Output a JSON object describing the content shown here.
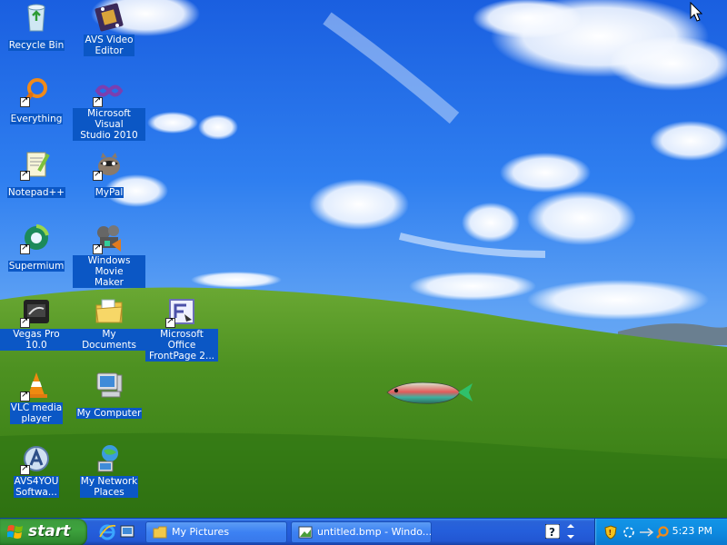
{
  "desktop": {
    "icons": [
      {
        "label": "Recycle Bin",
        "icon": "recycle-bin-icon",
        "shortcut": false
      },
      {
        "label": "AVS Video\nEditor",
        "icon": "film-icon",
        "shortcut": false
      },
      {
        "label": "Everything",
        "icon": "magnifier-icon",
        "shortcut": true
      },
      {
        "label": "Microsoft Visual\nStudio 2010",
        "icon": "visual-studio-icon",
        "shortcut": true
      },
      {
        "label": "Notepad++",
        "icon": "notepad-icon",
        "shortcut": true
      },
      {
        "label": "MyPal",
        "icon": "raccoon-icon",
        "shortcut": true
      },
      {
        "label": "Supermium",
        "icon": "globe-icon",
        "shortcut": true
      },
      {
        "label": "Windows Movie\nMaker",
        "icon": "movie-maker-icon",
        "shortcut": true
      },
      {
        "label": "Vegas Pro 10.0",
        "icon": "vegas-icon",
        "shortcut": true
      },
      {
        "label": "My Documents",
        "icon": "folder-icon",
        "shortcut": false
      },
      {
        "label": "Microsoft Office\nFrontPage 2...",
        "icon": "frontpage-icon",
        "shortcut": true
      },
      {
        "label": "VLC media\nplayer",
        "icon": "traffic-cone-icon",
        "shortcut": true
      },
      {
        "label": "My Computer",
        "icon": "computer-icon",
        "shortcut": false
      },
      {
        "label": "AVS4YOU\nSoftwa...",
        "icon": "avs-icon",
        "shortcut": true
      },
      {
        "label": "My Network\nPlaces",
        "icon": "network-icon",
        "shortcut": false
      }
    ]
  },
  "taskbar": {
    "start_label": "start",
    "quick_launch": [
      "internet-explorer-icon",
      "show-desktop-icon"
    ],
    "tasks": [
      {
        "label": "My Pictures",
        "icon": "folder-icon"
      },
      {
        "label": "untitled.bmp - Windo...",
        "icon": "paint-icon"
      }
    ],
    "tray_icons": [
      "security-shield-icon",
      "sync-icon",
      "network-tray-icon",
      "search-tray-icon"
    ],
    "clock": "5:23 PM"
  },
  "colors": {
    "taskbar_blue": "#245edb",
    "start_green": "#3ea33e",
    "tray_blue": "#0e8ae0",
    "label_highlight": "#0b57c5"
  }
}
